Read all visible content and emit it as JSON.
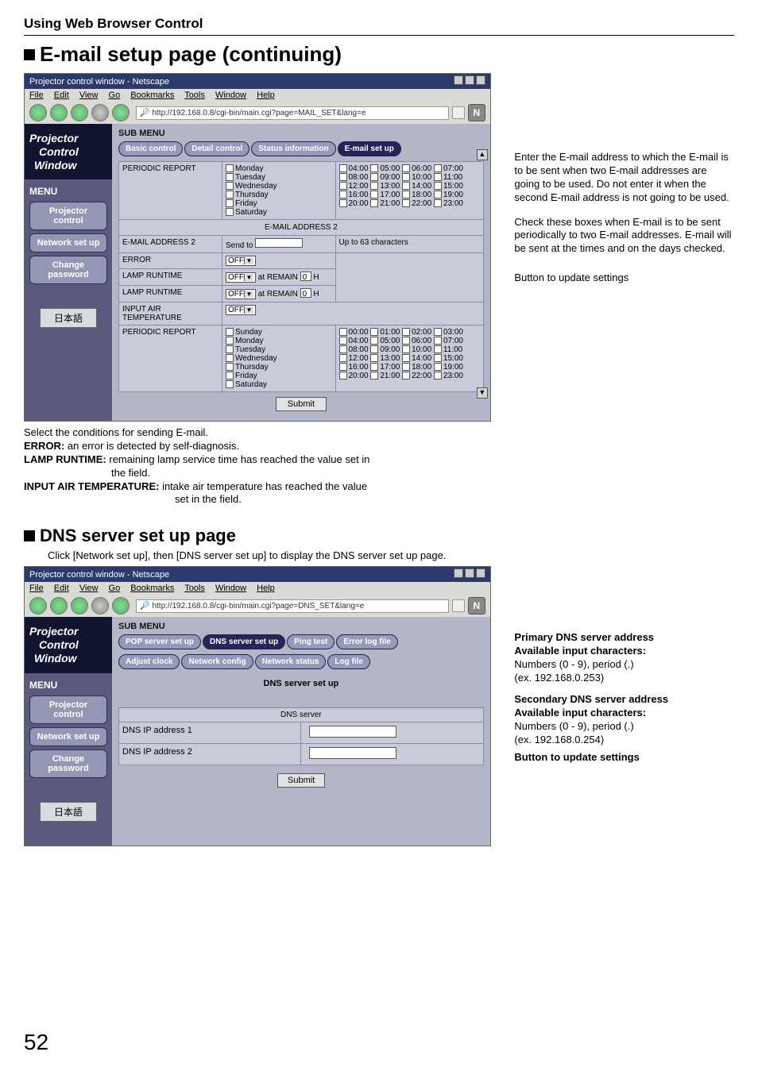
{
  "section_title": "Using Web Browser Control",
  "heading1": "E-mail setup page (continuing)",
  "heading2": "DNS server set up page",
  "intro_text2": "Click [Network set up], then [DNS server set up] to display the DNS server set up page.",
  "page_number": "52",
  "win_title": "Projector control window - Netscape",
  "menus": [
    "File",
    "Edit",
    "View",
    "Go",
    "Bookmarks",
    "Tools",
    "Window",
    "Help"
  ],
  "url1": "http://192.168.0.8/cgi-bin/main.cgi?page=MAIL_SET&lang=e",
  "url2": "http://192.168.0.8/cgi-bin/main.cgi?page=DNS_SET&lang=e",
  "logo_l1": "Projector",
  "logo_l2": "Control",
  "logo_l3": "Window",
  "side_menu": "MENU",
  "side_items": [
    "Projector control",
    "Network set up",
    "Change password"
  ],
  "japanese": "日本語",
  "sub_menu": "SUB MENU",
  "tabs1": [
    "Basic control",
    "Detail control",
    "Status information",
    "E-mail set up"
  ],
  "tabs2": [
    "POP server set up",
    "DNS server set up",
    "Ping test",
    "Error log file",
    "Adjust clock",
    "Network config",
    "Network status",
    "Log file"
  ],
  "periodic": "PERIODIC REPORT",
  "days": [
    "Monday",
    "Tuesday",
    "Wednesday",
    "Thursday",
    "Friday",
    "Saturday"
  ],
  "days_full": [
    "Sunday",
    "Monday",
    "Tuesday",
    "Wednesday",
    "Thursday",
    "Friday",
    "Saturday"
  ],
  "times_block1": [
    [
      "04:00",
      "05:00",
      "06:00",
      "07:00"
    ],
    [
      "08:00",
      "09:00",
      "10:00",
      "11:00"
    ],
    [
      "12:00",
      "13:00",
      "14:00",
      "15:00"
    ],
    [
      "16:00",
      "17:00",
      "18:00",
      "19:00"
    ],
    [
      "20:00",
      "21:00",
      "22:00",
      "23:00"
    ]
  ],
  "times_block2": [
    [
      "00:00",
      "01:00",
      "02:00",
      "03:00"
    ],
    [
      "04:00",
      "05:00",
      "06:00",
      "07:00"
    ],
    [
      "08:00",
      "09:00",
      "10:00",
      "11:00"
    ],
    [
      "12:00",
      "13:00",
      "14:00",
      "15:00"
    ],
    [
      "16:00",
      "17:00",
      "18:00",
      "19:00"
    ],
    [
      "20:00",
      "21:00",
      "22:00",
      "23:00"
    ]
  ],
  "sect2": "E-MAIL ADDRESS 2",
  "row_email2": "E-MAIL ADDRESS 2",
  "row_email2_lbl": "Send to",
  "row_email2_right": "Up to 63 characters",
  "row_error": "ERROR",
  "off": "OFF",
  "row_lamp": "LAMP RUNTIME",
  "at_remain": "at REMAIN",
  "zero": "0",
  "h": "H",
  "row_input_air": "INPUT AIR TEMPERATURE",
  "submit": "Submit",
  "anno1": "Enter the E-mail address to which the E-mail is to be sent when two E-mail addresses are going to be used. Do not enter it when the second E-mail address is not going to be used.",
  "anno2": "Check these boxes when E-mail is to be sent periodically to two E-mail addresses. E-mail will be sent at the times and on the days checked.",
  "anno3": "Button to update settings",
  "notes_intro": "Select the conditions for sending E-mail.",
  "notes_error": {
    "h": "ERROR:",
    "t": " an error is detected by self-diagnosis."
  },
  "notes_lamp_h": "LAMP RUNTIME:",
  "notes_lamp_t1": " remaining lamp service time has reached the value set in",
  "notes_lamp_t2": "the field.",
  "notes_air_h": "INPUT AIR TEMPERATURE:",
  "notes_air_t1": " intake air temperature has reached the value",
  "notes_air_t2": "set in the field.",
  "dns_title": "DNS server set up",
  "dns_server": "DNS server",
  "dns_ip1": "DNS IP address 1",
  "dns_ip2": "DNS IP address 2",
  "anno_dns1_h": "Primary DNS server address",
  "anno_dns_avail": "Available input characters:",
  "anno_dns1_t1": "Numbers (0 - 9), period (.)",
  "anno_dns1_t2": "(ex. 192.168.0.253)",
  "anno_dns2_h": "Secondary DNS server address",
  "anno_dns2_t2": "(ex. 192.168.0.254)",
  "anno_dns3": "Button to update settings"
}
